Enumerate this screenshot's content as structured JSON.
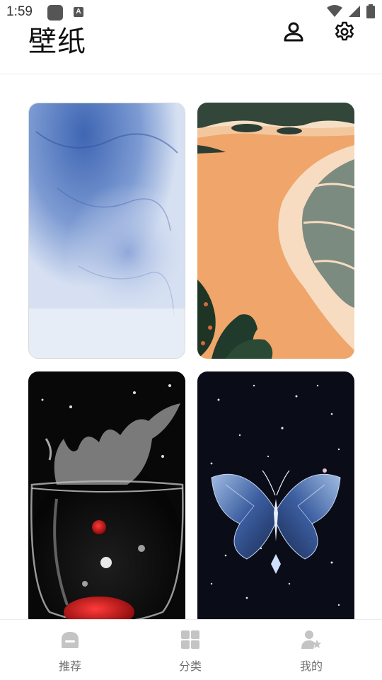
{
  "status_bar": {
    "time": "1:59",
    "app_icon_letter": "A"
  },
  "header": {
    "title": "壁纸",
    "profile_icon": "person-icon",
    "settings_icon": "gear-icon"
  },
  "wallpapers": [
    {
      "subject": "blue ink watercolor"
    },
    {
      "subject": "orange beach shoreline"
    },
    {
      "subject": "water splash in glass"
    },
    {
      "subject": "crystal butterfly"
    }
  ],
  "bottom_nav": {
    "items": [
      {
        "label": "推荐",
        "icon": "home-icon",
        "active": true
      },
      {
        "label": "分类",
        "icon": "grid-icon",
        "active": false
      },
      {
        "label": "我的",
        "icon": "user-star-icon",
        "active": false
      }
    ]
  },
  "colors": {
    "icon_gray": "#c4c4c4",
    "label_gray": "#6f6f6f"
  }
}
